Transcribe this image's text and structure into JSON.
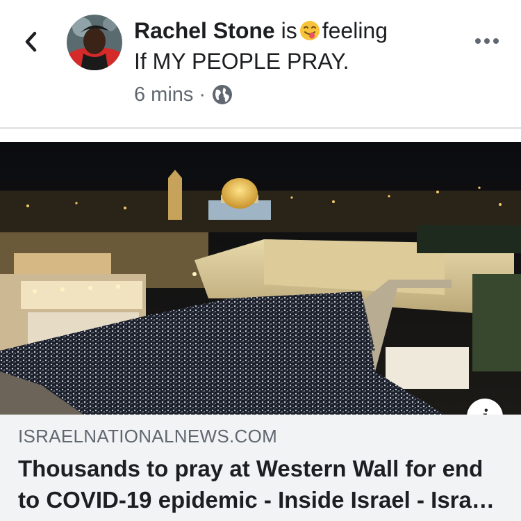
{
  "post": {
    "author": "Rachel Stone",
    "connector": "is",
    "feeling_word": "feeling",
    "feeling_text": "If MY PEOPLE PRAY.",
    "time": "6 mins",
    "separator": "·",
    "audience_icon": "globe-icon",
    "emoji_icon": "smiling-face-with-tongue-icon"
  },
  "link": {
    "domain": "ISRAELNATIONALNEWS.COM",
    "title": "Thousands to pray at Western Wall for end to COVID-19 epidemic - Inside Israel - Israel National News"
  },
  "colors": {
    "text_primary": "#1c1e21",
    "text_secondary": "#606770",
    "link_background": "#f2f3f5",
    "divider": "#dadde1"
  }
}
